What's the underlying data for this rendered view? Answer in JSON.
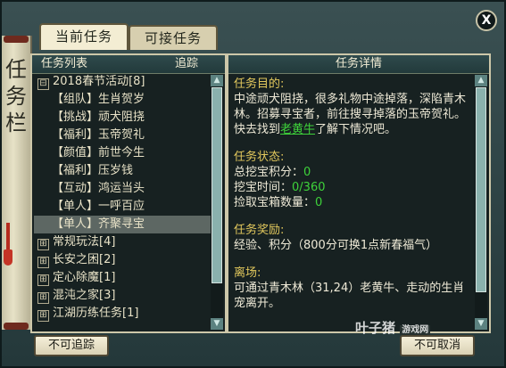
{
  "side": {
    "chars": [
      "任",
      "务",
      "栏"
    ]
  },
  "close": {
    "glyph": "X"
  },
  "tabs": [
    {
      "label": "当前任务",
      "active": true
    },
    {
      "label": "可接任务",
      "active": false
    }
  ],
  "left_panel": {
    "header_left": "任务列表",
    "header_right": "追踪",
    "items": [
      {
        "sign": "⊟",
        "label": "2018春节活动[8]",
        "type": "group"
      },
      {
        "label": "【组队】生肖贺岁",
        "type": "sub"
      },
      {
        "label": "【挑战】顽犬阻挠",
        "type": "sub"
      },
      {
        "label": "【福利】玉帝贺礼",
        "type": "sub"
      },
      {
        "label": "【颜值】前世今生",
        "type": "sub"
      },
      {
        "label": "【福利】压岁钱",
        "type": "sub"
      },
      {
        "label": "【互动】鸿运当头",
        "type": "sub"
      },
      {
        "label": "【单人】一呼百应",
        "type": "sub"
      },
      {
        "label": "【单人】齐聚寻宝",
        "type": "sub",
        "selected": true
      },
      {
        "sign": "⊞",
        "label": "常规玩法[4]",
        "type": "group"
      },
      {
        "sign": "⊞",
        "label": "长安之困[2]",
        "type": "group"
      },
      {
        "sign": "⊞",
        "label": "定心除魔[1]",
        "type": "group"
      },
      {
        "sign": "⊞",
        "label": "混沌之家[3]",
        "type": "group"
      },
      {
        "sign": "⊞",
        "label": "江湖历练任务[1]",
        "type": "group"
      }
    ]
  },
  "right_panel": {
    "header": "任务详情",
    "goal_title": "任务目的:",
    "goal_text_1": "中途顽犬阻挠，很多礼物中途掉落，深陷青木林。招募寻宝者，前往搜寻掉落的玉帝贺礼。快去找到",
    "goal_link": "老黄牛",
    "goal_text_2": "了解下情况吧。",
    "status_title": "任务状态:",
    "status_lines": [
      {
        "label": "总挖宝积分：",
        "value": "0"
      },
      {
        "label": "挖宝时间：",
        "value": "0/360"
      },
      {
        "label": "捡取宝箱数量：",
        "value": "0"
      }
    ],
    "reward_title": "任务奖励:",
    "reward_text": "经验、积分（800分可换1点新春福气）",
    "leave_title": "离场:",
    "leave_text": "可通过青木林（31,24）老黄牛、走动的生肖宠离开。"
  },
  "buttons": {
    "untrack": "不可追踪",
    "cancel": "不可取消"
  },
  "watermark": {
    "text": "叶子猪",
    "sub": "游戏网"
  }
}
